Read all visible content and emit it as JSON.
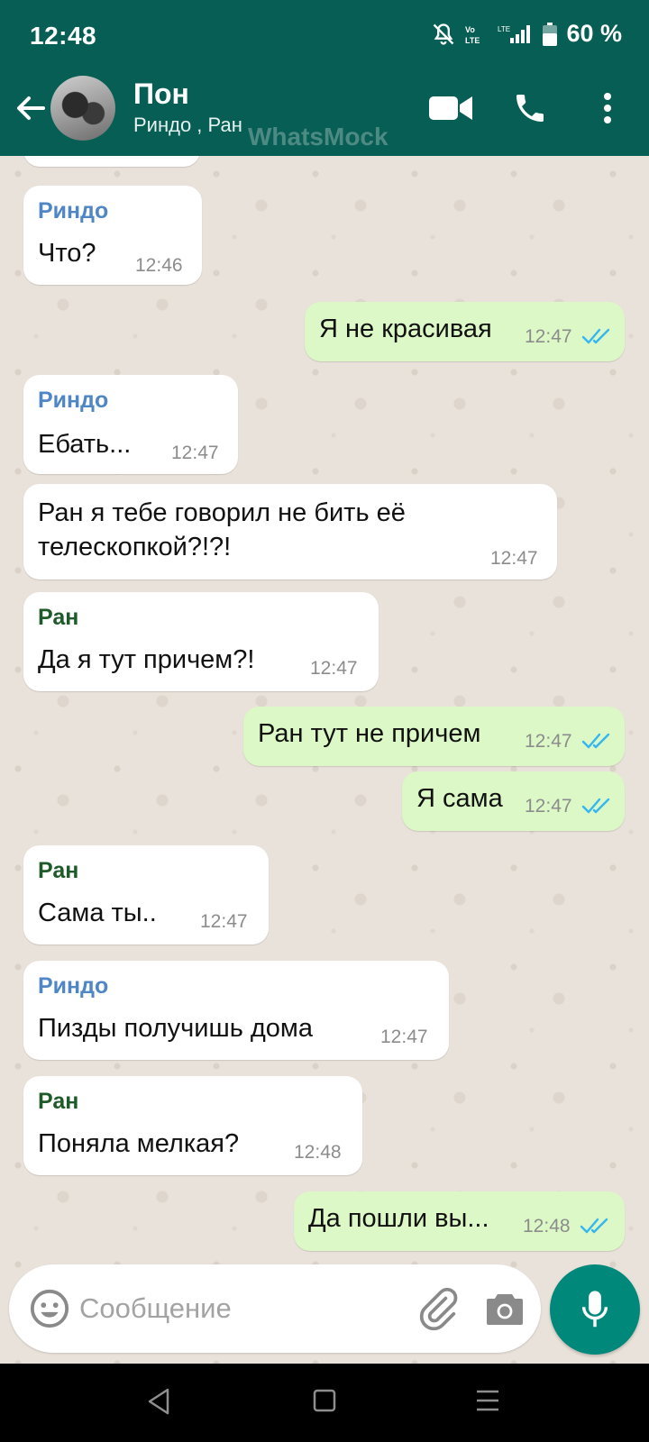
{
  "status": {
    "time": "12:48",
    "battery": "60 %",
    "volte": "Vo LTE",
    "lte": "LTE"
  },
  "header": {
    "title": "Пон",
    "subtitle": "Риндо , Ран",
    "watermark": "WhatsMock"
  },
  "messages": [
    {
      "dir": "in",
      "sender": "Риндо",
      "text": "Что?",
      "time": "12:46"
    },
    {
      "dir": "out",
      "text": "Я не красивая",
      "time": "12:47"
    },
    {
      "dir": "in",
      "sender": "Риндо",
      "text": "Ебать...",
      "time": "12:47"
    },
    {
      "dir": "in",
      "text": "Ран я тебе говорил не бить её телескопкой?!?!",
      "time": "12:47"
    },
    {
      "dir": "in",
      "sender": "Ран",
      "text": "Да я тут причем?!",
      "time": "12:47"
    },
    {
      "dir": "out",
      "text": "Ран тут не причем",
      "time": "12:47"
    },
    {
      "dir": "out",
      "text": "Я сама",
      "time": "12:47"
    },
    {
      "dir": "in",
      "sender": "Ран",
      "text": "Сама ты..",
      "time": "12:47"
    },
    {
      "dir": "in",
      "sender": "Риндо",
      "text": "Пизды получишь дома",
      "time": "12:47"
    },
    {
      "dir": "in",
      "sender": "Ран",
      "text": "Поняла мелкая?",
      "time": "12:48"
    },
    {
      "dir": "out",
      "text": "Да пошли вы...",
      "time": "12:48"
    }
  ],
  "input": {
    "placeholder": "Сообщение"
  },
  "colors": {
    "header": "#075e54",
    "outgoing": "#dcf8c6",
    "incoming": "#ffffff",
    "tick": "#34b7f1",
    "mic": "#00897b",
    "sender_rindo": "#4f86c6",
    "sender_ran": "#1f5a2a"
  }
}
